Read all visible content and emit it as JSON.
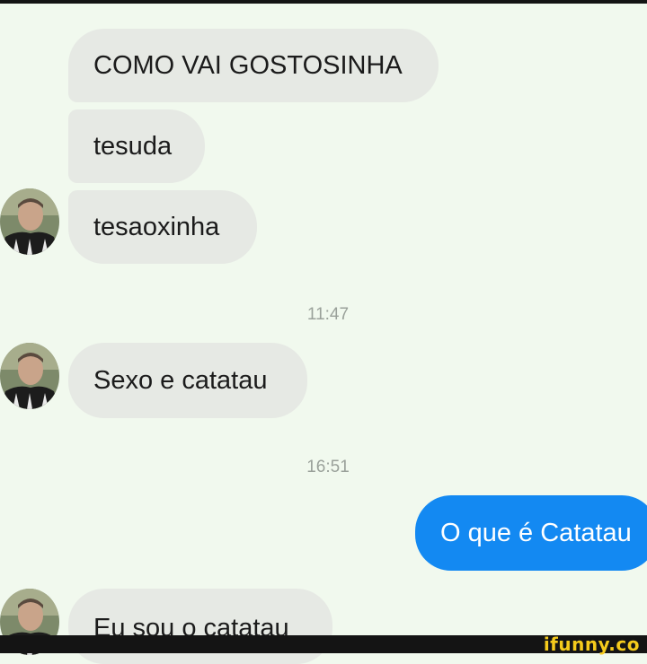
{
  "conversation": {
    "messages": [
      {
        "text": "COMO VAI GOSTOSINHA",
        "direction": "incoming"
      },
      {
        "text": "tesuda",
        "direction": "incoming"
      },
      {
        "text": "tesaoxinha",
        "direction": "incoming"
      },
      {
        "text": "Sexo e catatau",
        "direction": "incoming"
      },
      {
        "text": "O que é Catatau",
        "direction": "outgoing"
      },
      {
        "text": "Eu sou o catatau",
        "direction": "incoming"
      }
    ],
    "timestamps": [
      "11:47",
      "16:51"
    ]
  },
  "watermark": "ifunny.co",
  "colors": {
    "background": "#f1f9ee",
    "incoming_bubble": "#e6e9e4",
    "outgoing_bubble": "#1389f2",
    "timestamp": "#9aa19a",
    "watermark": "#f5cb1c"
  },
  "icons": {
    "avatar": "contact-avatar"
  }
}
